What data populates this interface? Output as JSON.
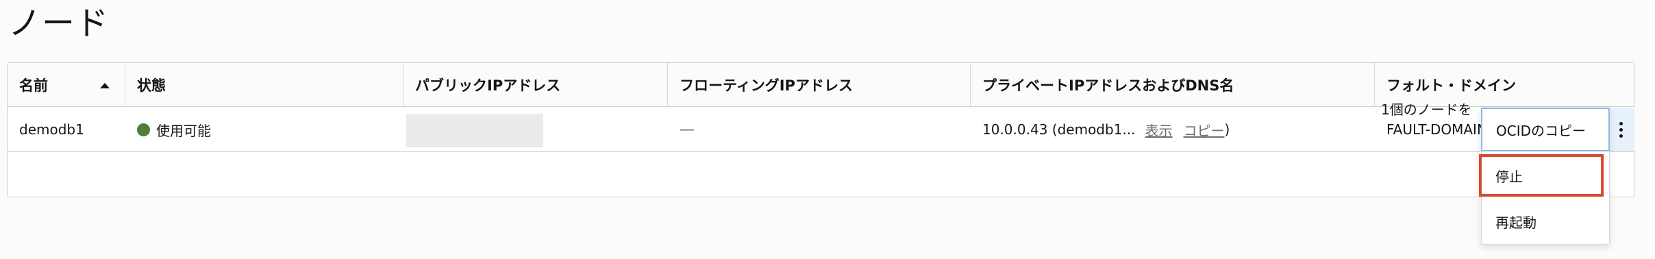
{
  "page": {
    "title": "ノード"
  },
  "table": {
    "columns": [
      {
        "label": "名前",
        "sortable": true,
        "sort": "ascending"
      },
      {
        "label": "状態"
      },
      {
        "label": "パブリックIPアドレス"
      },
      {
        "label": "フローティングIPアドレス"
      },
      {
        "label": "プライベートIPアドレスおよびDNS名"
      },
      {
        "label": "フォルト・ドメイン"
      }
    ],
    "rows": [
      {
        "name": "demodb1",
        "status": "使用可能",
        "status_color": "#4f7d3b",
        "public_ip": "",
        "floating_ip": "—",
        "private_ip": "10.0.0.43 (demodb1...",
        "show_link": "表示",
        "copy_link": "コピー",
        "paren_close": ")",
        "fault_domain": "FAULT-DOMAIN"
      }
    ],
    "footer": "1個のノードを"
  },
  "action_menu": {
    "items": [
      {
        "label": "OCIDのコピー",
        "state": "focused"
      },
      {
        "label": "停止",
        "state": "highlighted"
      },
      {
        "label": "再起動"
      }
    ]
  },
  "icons": {
    "sort": "sort-ascending-icon",
    "status": "status-dot-icon",
    "kebab": "kebab-menu-icon",
    "next": "chevron-right-icon"
  },
  "colors": {
    "accent_focus": "#8fb7e3",
    "highlight_border": "#d84a31",
    "status_available": "#4f7d3b"
  }
}
